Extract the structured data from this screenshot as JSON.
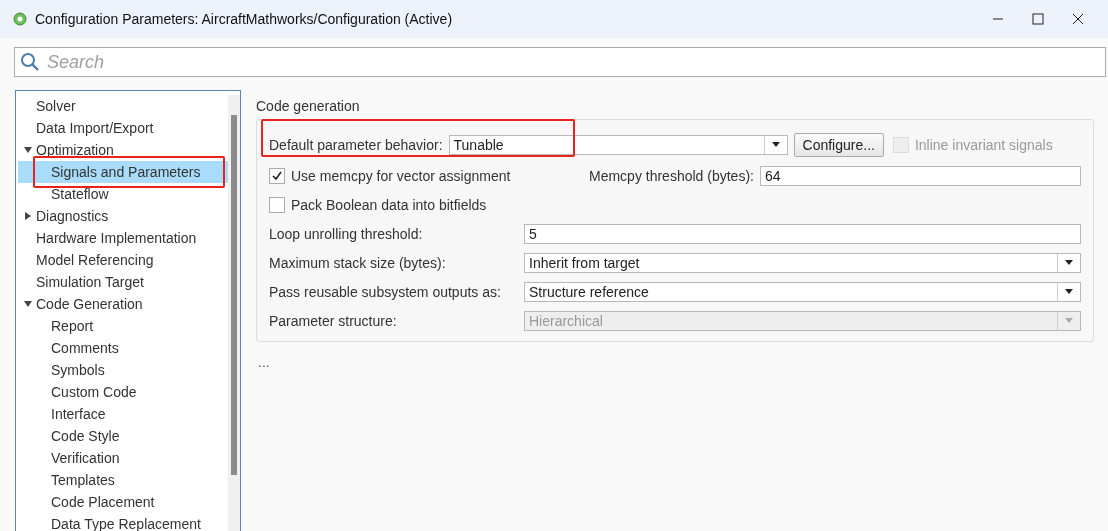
{
  "window": {
    "title": "Configuration Parameters: AircraftMathworks/Configuration (Active)"
  },
  "search": {
    "placeholder": "Search"
  },
  "tree": {
    "items": [
      {
        "label": "Solver",
        "selected": false,
        "highlighted": false
      },
      {
        "label": "Data Import/Export",
        "selected": false,
        "highlighted": false
      },
      {
        "label": "Optimization",
        "selected": false,
        "highlighted": false,
        "expanded": true,
        "children": [
          {
            "label": "Signals and Parameters",
            "selected": true,
            "highlighted": true
          },
          {
            "label": "Stateflow",
            "selected": false,
            "highlighted": false
          }
        ]
      },
      {
        "label": "Diagnostics",
        "selected": false,
        "expanded": false
      },
      {
        "label": "Hardware Implementation",
        "selected": false,
        "highlighted": false
      },
      {
        "label": "Model Referencing",
        "selected": false,
        "highlighted": false
      },
      {
        "label": "Simulation Target",
        "selected": false,
        "highlighted": false
      },
      {
        "label": "Code Generation",
        "selected": false,
        "highlighted": false,
        "expanded": true,
        "children": [
          {
            "label": "Report",
            "selected": false,
            "highlighted": false
          },
          {
            "label": "Comments",
            "selected": false,
            "highlighted": false
          },
          {
            "label": "Symbols",
            "selected": false,
            "highlighted": false
          },
          {
            "label": "Custom Code",
            "selected": false,
            "highlighted": false
          },
          {
            "label": "Interface",
            "selected": false,
            "highlighted": false
          },
          {
            "label": "Code Style",
            "selected": false,
            "highlighted": false
          },
          {
            "label": "Verification",
            "selected": false,
            "highlighted": false
          },
          {
            "label": "Templates",
            "selected": false,
            "highlighted": false
          },
          {
            "label": "Code Placement",
            "selected": false,
            "highlighted": false
          },
          {
            "label": "Data Type Replacement",
            "selected": false,
            "highlighted": false
          }
        ]
      }
    ]
  },
  "panel": {
    "title": "Code generation",
    "rows": [
      {
        "kind": "combo-configure",
        "label": "Default parameter behavior:",
        "value": "Tunable",
        "highlighted": true,
        "button": "Configure...",
        "checkbox": {
          "label": "Inline invariant signals",
          "checked": false,
          "disabled": true
        }
      },
      {
        "kind": "check-field",
        "checkbox": {
          "label": "Use memcpy for vector assignment",
          "checked": true,
          "disabled": false
        },
        "field_label": "Memcpy threshold (bytes):",
        "value": "64"
      },
      {
        "kind": "check",
        "checkbox": {
          "label": "Pack Boolean data into bitfields",
          "checked": false,
          "disabled": false
        }
      },
      {
        "kind": "text",
        "label": "Loop unrolling threshold:",
        "value": "5",
        "disabled": false
      },
      {
        "kind": "dropdown",
        "label": "Maximum stack size (bytes):",
        "value": "Inherit from target",
        "disabled": false
      },
      {
        "kind": "dropdown",
        "label": "Pass reusable subsystem outputs as:",
        "value": "Structure reference",
        "disabled": false
      },
      {
        "kind": "dropdown",
        "label": "Parameter structure:",
        "value": "Hierarchical",
        "disabled": true
      }
    ],
    "footer": "..."
  }
}
